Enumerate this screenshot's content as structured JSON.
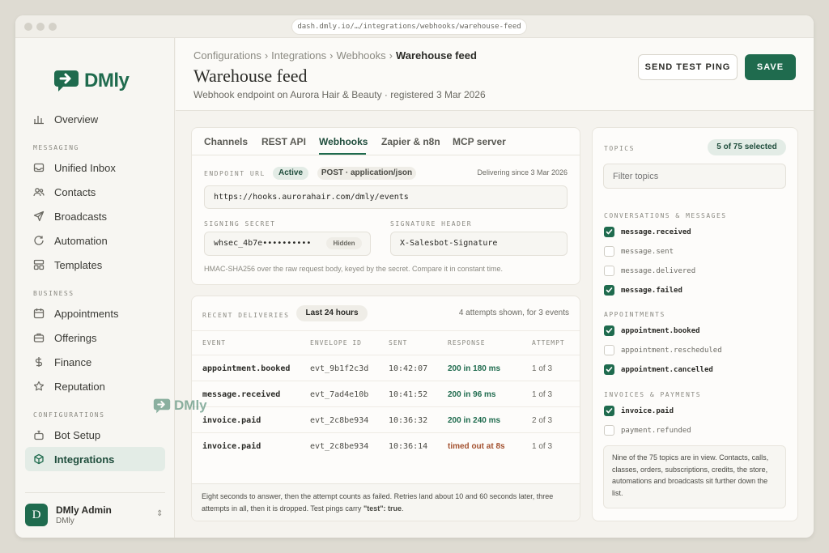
{
  "browser": {
    "url": "dash.dmly.io/…/integrations/webhooks/warehouse-feed"
  },
  "brand": {
    "name": "DMly",
    "accent": "#1f6b4e"
  },
  "sidebar": {
    "top_item": {
      "label": "Overview",
      "icon": "bar-chart-icon"
    },
    "sections": [
      {
        "title": "MESSAGING",
        "items": [
          {
            "label": "Unified Inbox",
            "icon": "inbox-icon"
          },
          {
            "label": "Contacts",
            "icon": "people-icon"
          },
          {
            "label": "Broadcasts",
            "icon": "send-icon"
          },
          {
            "label": "Automation",
            "icon": "refresh-icon"
          },
          {
            "label": "Templates",
            "icon": "layout-icon"
          }
        ]
      },
      {
        "title": "BUSINESS",
        "items": [
          {
            "label": "Appointments",
            "icon": "calendar-icon"
          },
          {
            "label": "Offerings",
            "icon": "briefcase-icon"
          },
          {
            "label": "Finance",
            "icon": "dollar-icon"
          },
          {
            "label": "Reputation",
            "icon": "star-icon"
          }
        ]
      },
      {
        "title": "CONFIGURATIONS",
        "items": [
          {
            "label": "Bot Setup",
            "icon": "bot-icon"
          },
          {
            "label": "Integrations",
            "icon": "cube-icon",
            "active": true
          }
        ]
      }
    ],
    "user": {
      "initial": "D",
      "name": "DMly Admin",
      "org": "DMly"
    }
  },
  "header": {
    "breadcrumbs": [
      "Configurations",
      "Integrations",
      "Webhooks"
    ],
    "crumb_sep": "›",
    "current": "Warehouse feed",
    "title": "Warehouse feed",
    "subtitle": "Webhook endpoint on Aurora Hair & Beauty · registered 3 Mar 2026",
    "ping_label": "SEND TEST PING",
    "save_label": "SAVE"
  },
  "tabs": [
    "Channels",
    "REST API",
    "Webhooks",
    "Zapier & n8n",
    "MCP server"
  ],
  "active_tab": "Webhooks",
  "endpoint": {
    "label": "ENDPOINT URL",
    "status": "Active",
    "method": "POST · application/json",
    "since": "Delivering since 3 Mar 2026",
    "url": "https://hooks.aurorahair.com/dmly/events",
    "secret_label": "SIGNING SECRET",
    "secret_value": "whsec_4b7e••••••••••",
    "secret_badge": "Hidden",
    "header_label": "SIGNATURE HEADER",
    "header_value": "X-Salesbot-Signature",
    "hint": "HMAC-SHA256 over the raw request body, keyed by the secret. Compare it in constant time."
  },
  "deliveries": {
    "label": "RECENT DELIVERIES",
    "filter": "Last 24 hours",
    "summary": "4 attempts shown, for 3 events",
    "columns": [
      "EVENT",
      "ENVELOPE ID",
      "SENT",
      "RESPONSE",
      "ATTEMPT"
    ],
    "rows": [
      {
        "event": "appointment.booked",
        "id": "evt_9b1f2c3d",
        "sent": "10:42:07",
        "response": "200 in 180 ms",
        "ok": true,
        "attempt": "1 of 3"
      },
      {
        "event": "message.received",
        "id": "evt_7ad4e10b",
        "sent": "10:41:52",
        "response": "200 in 96 ms",
        "ok": true,
        "attempt": "1 of 3"
      },
      {
        "event": "invoice.paid",
        "id": "evt_2c8be934",
        "sent": "10:36:32",
        "response": "200 in 240 ms",
        "ok": true,
        "attempt": "2 of 3"
      },
      {
        "event": "invoice.paid",
        "id": "evt_2c8be934",
        "sent": "10:36:14",
        "response": "timed out at 8s",
        "ok": false,
        "attempt": "1 of 3"
      }
    ],
    "footnote_text": "Eight seconds to answer, then the attempt counts as failed. Retries land about 10 and 60 seconds later, three attempts in all, then it is dropped. Test pings carry ",
    "footnote_code": "\"test\": true",
    "footnote_end": "."
  },
  "topics": {
    "label": "TOPICS",
    "count": "5 of 75 selected",
    "filter_placeholder": "Filter topics",
    "groups": [
      {
        "title": "CONVERSATIONS & MESSAGES",
        "items": [
          {
            "name": "message.received",
            "checked": true
          },
          {
            "name": "message.sent",
            "checked": false
          },
          {
            "name": "message.delivered",
            "checked": false
          },
          {
            "name": "message.failed",
            "checked": true
          }
        ]
      },
      {
        "title": "APPOINTMENTS",
        "items": [
          {
            "name": "appointment.booked",
            "checked": true
          },
          {
            "name": "appointment.rescheduled",
            "checked": false
          },
          {
            "name": "appointment.cancelled",
            "checked": true
          }
        ]
      },
      {
        "title": "INVOICES & PAYMENTS",
        "items": [
          {
            "name": "invoice.paid",
            "checked": true
          },
          {
            "name": "payment.refunded",
            "checked": false
          }
        ]
      }
    ],
    "note": "Nine of the 75 topics are in view. Contacts, calls, classes, orders, subscriptions, credits, the store, automations and broadcasts sit further down the list."
  }
}
